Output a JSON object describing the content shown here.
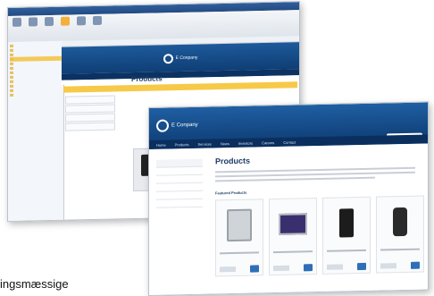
{
  "back_window": {
    "ribbon_tabs": [
      "",
      "",
      "",
      "",
      "",
      ""
    ],
    "ribbon_buttons": [
      "",
      "",
      "",
      "",
      "",
      ""
    ],
    "tree_nodes": [
      "",
      "",
      "",
      "",
      "",
      "",
      "",
      "",
      "",
      "",
      "",
      "",
      "",
      ""
    ],
    "logo_text": "E Conpany",
    "page_title": "Products",
    "left_menu": [
      "",
      "",
      "",
      "",
      "",
      ""
    ]
  },
  "front_window": {
    "logo_text": "E Conpany",
    "nav": [
      "Home",
      "Products",
      "Services",
      "News",
      "Investors",
      "Careers",
      "Contact"
    ],
    "left_menu": [
      "",
      "",
      "",
      "",
      "",
      ""
    ],
    "title": "Products",
    "featured_label": "Featured Products",
    "cards": [
      {
        "device": "tablet"
      },
      {
        "device": "laptop"
      },
      {
        "device": "phone"
      },
      {
        "device": "phone2"
      }
    ]
  },
  "caption": "ingsmæssige"
}
